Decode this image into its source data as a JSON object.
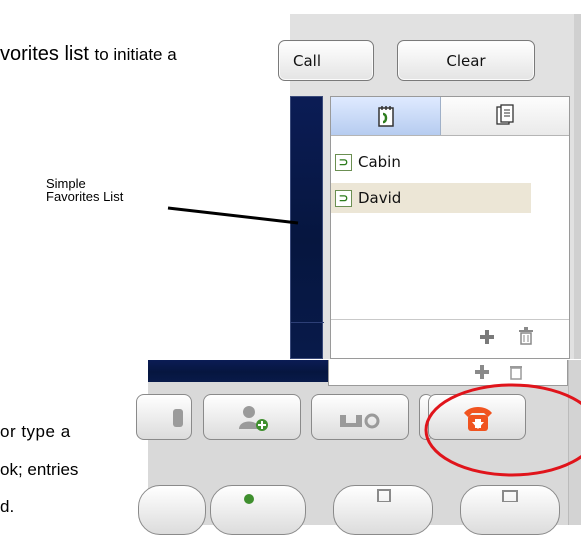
{
  "doc": {
    "line1_a": "vorites list",
    "line1_b": "to initiate a",
    "line2": "or type a",
    "line3": "ok; entries",
    "line4": "d."
  },
  "callout": {
    "label_line1": "Simple",
    "label_line2": "Favorites List"
  },
  "toolbar": {
    "call_label": "Call",
    "clear_label": "Clear"
  },
  "favorites": {
    "items": [
      {
        "name": "Cabin",
        "icon": "phone-contact-icon",
        "selected": false
      },
      {
        "name": "David",
        "icon": "phone-contact-icon",
        "selected": true
      }
    ],
    "tabs": [
      {
        "icon": "favorites-book-icon",
        "active": true
      },
      {
        "icon": "directory-icon",
        "active": false
      }
    ]
  },
  "colors": {
    "highlight_ellipse": "#e0141b",
    "hangup_button": "#f0531f",
    "selected_row": "#ece6d6",
    "active_tab": "#c4d6f5"
  }
}
